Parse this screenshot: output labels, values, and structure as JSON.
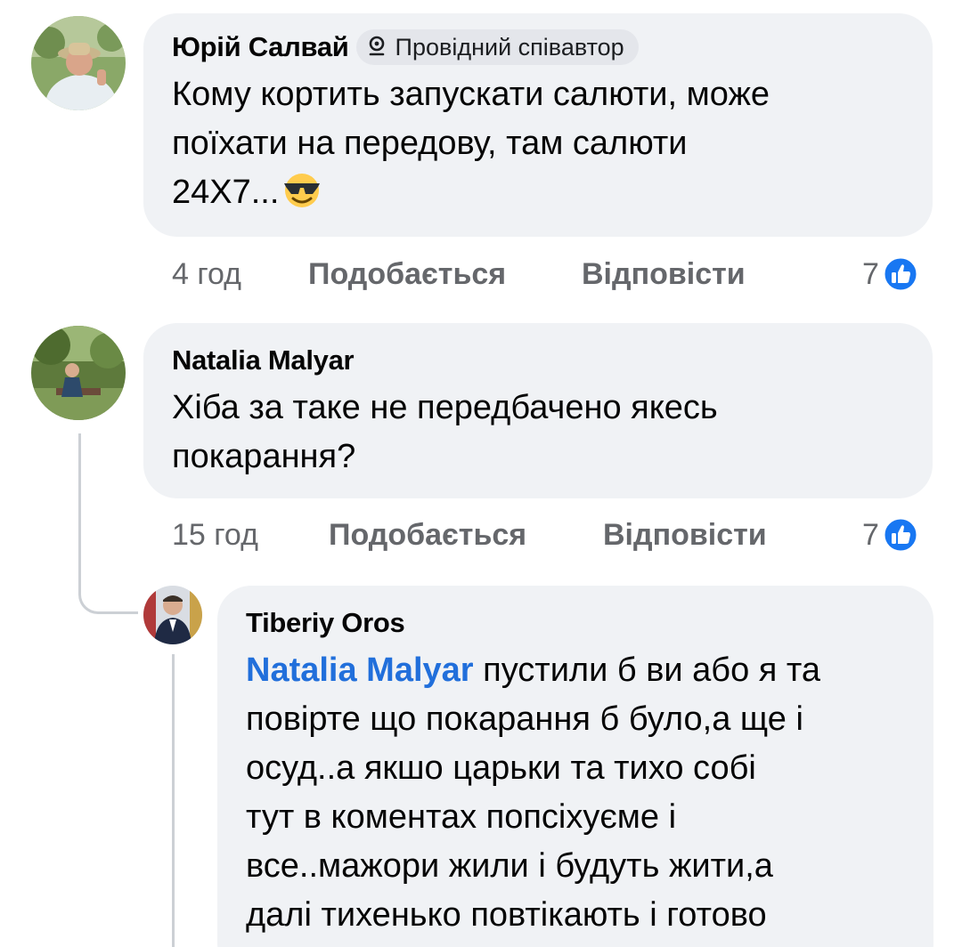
{
  "comments": [
    {
      "author": "Юрій Салвай",
      "badge": "Провідний співавтор",
      "text_lines": [
        "Кому кортить запускати салюти, може",
        "поїхати на передову, там салюти",
        "24Х7..."
      ],
      "emoji": "smiling-face-with-sunglasses",
      "time": "4 год",
      "like_label": "Подобається",
      "reply_label": "Відповісти",
      "reaction_count": "7"
    },
    {
      "author": "Natalia Malyar",
      "text_lines": [
        "Хіба за таке не передбачено якесь",
        "покарання?"
      ],
      "time": "15 год",
      "like_label": "Подобається",
      "reply_label": "Відповісти",
      "reaction_count": "7"
    },
    {
      "author": "Tiberiy Oros",
      "mention": "Natalia Malyar",
      "first_line_rest": " пустили б ви або я та",
      "text_lines": [
        "повірте що покарання б було,а ще і",
        "осуд..а якшо царьки та тихо собі",
        "тут в коментах попсіхуєме і",
        "все..мажори жили і будуть жити,а",
        "далі тихенько повтікають і готово"
      ]
    }
  ],
  "colors": {
    "bubble": "#f0f2f5",
    "meta": "#65676b",
    "link": "#216fdb",
    "like_blue": "#1877f2"
  },
  "icons": [
    "badge-icon",
    "like-reaction-icon",
    "emoji-sunglasses-icon"
  ]
}
